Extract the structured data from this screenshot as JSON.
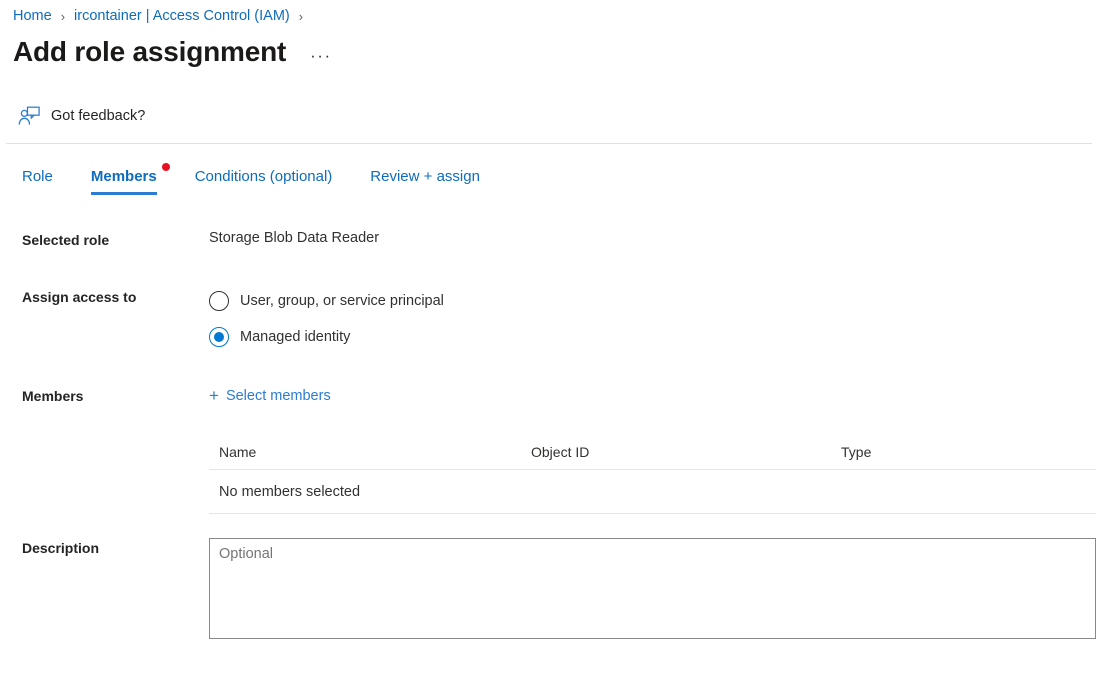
{
  "breadcrumb": {
    "items": [
      {
        "label": "Home"
      },
      {
        "label": "ircontainer | Access Control (IAM)"
      }
    ],
    "separator": "›"
  },
  "header": {
    "title": "Add role assignment",
    "more_label": "···"
  },
  "feedback": {
    "label": "Got feedback?",
    "icon": "feedback-person-icon"
  },
  "tabs": [
    {
      "label": "Role",
      "active": false,
      "badge": false
    },
    {
      "label": "Members",
      "active": true,
      "badge": true
    },
    {
      "label": "Conditions (optional)",
      "active": false,
      "badge": false
    },
    {
      "label": "Review + assign",
      "active": false,
      "badge": false
    }
  ],
  "form": {
    "selected_role": {
      "label": "Selected role",
      "value": "Storage Blob Data Reader"
    },
    "assign_access_to": {
      "label": "Assign access to",
      "options": [
        {
          "label": "User, group, or service principal",
          "selected": false
        },
        {
          "label": "Managed identity",
          "selected": true
        }
      ]
    },
    "members": {
      "label": "Members",
      "select_action": "Select members",
      "plus_icon": "plus-icon",
      "table": {
        "columns": [
          "Name",
          "Object ID",
          "Type"
        ],
        "rows": [],
        "empty_text": "No members selected"
      }
    },
    "description": {
      "label": "Description",
      "value": "",
      "placeholder": "Optional"
    }
  },
  "colors": {
    "accent": "#0078d4",
    "link": "#0f6cbd",
    "tab_link": "#2b7cd3",
    "badge_red": "#e81123",
    "divider": "#e1e1e1",
    "text": "#323130"
  }
}
